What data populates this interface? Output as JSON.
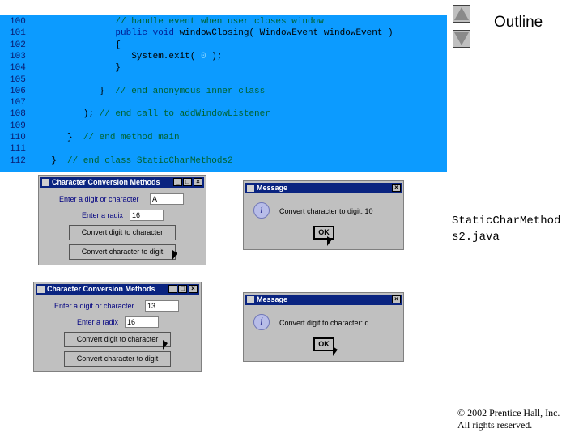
{
  "code": {
    "lines": [
      {
        "n": "100",
        "indent": 14,
        "parts": [
          {
            "c": "cm",
            "t": "// handle event when user closes window"
          }
        ]
      },
      {
        "n": "101",
        "indent": 14,
        "parts": [
          {
            "c": "k",
            "t": "public void "
          },
          {
            "c": "p",
            "t": "windowClosing( WindowEvent windowEvent )"
          }
        ]
      },
      {
        "n": "102",
        "indent": 14,
        "parts": [
          {
            "c": "p",
            "t": "{"
          }
        ]
      },
      {
        "n": "103",
        "indent": 17,
        "parts": [
          {
            "c": "p",
            "t": "System.exit( "
          },
          {
            "c": "num",
            "t": "0"
          },
          {
            "c": "p",
            "t": " );"
          }
        ]
      },
      {
        "n": "104",
        "indent": 14,
        "parts": [
          {
            "c": "p",
            "t": "}"
          }
        ]
      },
      {
        "n": "105",
        "indent": 0,
        "parts": []
      },
      {
        "n": "106",
        "indent": 11,
        "parts": [
          {
            "c": "p",
            "t": "}  "
          },
          {
            "c": "cm",
            "t": "// end anonymous inner class"
          }
        ]
      },
      {
        "n": "107",
        "indent": 0,
        "parts": []
      },
      {
        "n": "108",
        "indent": 8,
        "parts": [
          {
            "c": "p",
            "t": "); "
          },
          {
            "c": "cm",
            "t": "// end call to addWindowListener"
          }
        ]
      },
      {
        "n": "109",
        "indent": 0,
        "parts": []
      },
      {
        "n": "110",
        "indent": 5,
        "parts": [
          {
            "c": "p",
            "t": "}  "
          },
          {
            "c": "cm",
            "t": "// end method main"
          }
        ]
      },
      {
        "n": "111",
        "indent": 0,
        "parts": []
      },
      {
        "n": "112",
        "indent": 2,
        "parts": [
          {
            "c": "p",
            "t": "}  "
          },
          {
            "c": "cm",
            "t": "// end class StaticCharMethods2"
          }
        ]
      }
    ]
  },
  "nav": {
    "up_icon": "triangle-up-icon",
    "down_icon": "triangle-down-icon"
  },
  "outline_label": "Outline",
  "filename": "StaticCharMethod\ns2.java",
  "copyright": "© 2002 Prentice Hall, Inc.\nAll rights reserved.",
  "windows": {
    "app1": {
      "title": "Character Conversion Methods",
      "digit_label": "Enter a digit or character",
      "digit_value": "A",
      "radix_label": "Enter a radix",
      "radix_value": "16",
      "btn_to_char": "Convert digit to character",
      "btn_to_digit": "Convert character to digit"
    },
    "msg1": {
      "title": "Message",
      "text": "Convert character to digit: 10",
      "ok": "OK"
    },
    "app2": {
      "title": "Character Conversion Methods",
      "digit_label": "Enter a digit or character",
      "digit_value": "13",
      "radix_label": "Enter a radix",
      "radix_value": "16",
      "btn_to_char": "Convert digit to character",
      "btn_to_digit": "Convert character to digit"
    },
    "msg2": {
      "title": "Message",
      "text": "Convert digit to character: d",
      "ok": "OK"
    }
  },
  "colors": {
    "code_bg": "#0c9bff",
    "titlebar": "#0a2480",
    "window_bg": "#c0c0c0"
  }
}
